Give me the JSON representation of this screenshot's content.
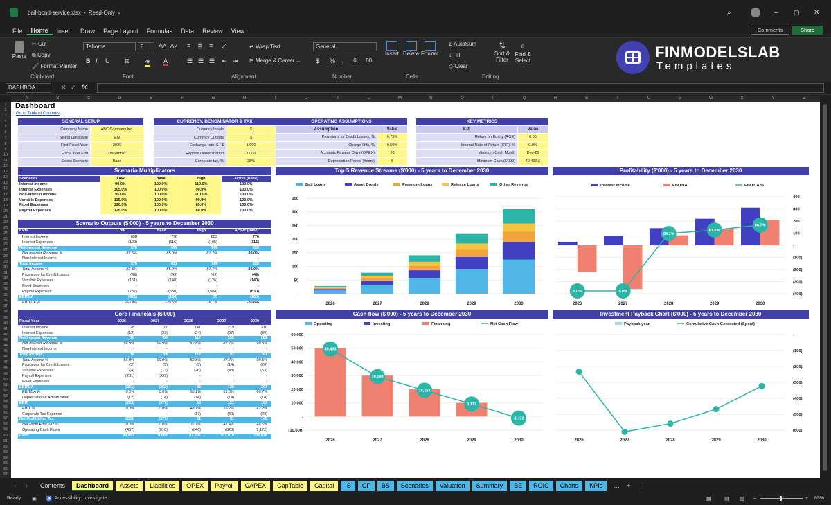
{
  "window": {
    "file": "bail-bond-service.xlsx",
    "mode": "Read-Only"
  },
  "menu": [
    "File",
    "Home",
    "Insert",
    "Draw",
    "Page Layout",
    "Formulas",
    "Data",
    "Review",
    "View"
  ],
  "buttons": {
    "comments": "Comments",
    "share": "Share"
  },
  "ribbon": {
    "paste": "Paste",
    "cut": "Cut",
    "copy": "Copy",
    "format_painter": "Format Painter",
    "clipboard": "Clipboard",
    "font_name": "Tahoma",
    "font_size": "8",
    "font": "Font",
    "wrap": "Wrap Text",
    "merge": "Merge & Center",
    "alignment": "Alignment",
    "number_format": "General",
    "number": "Number",
    "insert": "Insert",
    "delete": "Delete",
    "format": "Format",
    "cells": "Cells",
    "autosum": "AutoSum",
    "fill": "Fill",
    "clear": "Clear",
    "sort": "Sort & Filter",
    "find": "Find & Select",
    "editing": "Editing"
  },
  "brand": {
    "name": "FINMODELSLAB",
    "sub": "Templates"
  },
  "namebox": "DASHBOA...",
  "columns": [
    "A",
    "B",
    "C",
    "D",
    "E",
    "F",
    "G",
    "H",
    "I",
    "J",
    "K",
    "L",
    "M",
    "N",
    "O",
    "P",
    "Q",
    "R",
    "S",
    "T",
    "U",
    "V",
    "W",
    "X",
    "Y",
    "Z"
  ],
  "dash": {
    "title": "Dashboard",
    "link": "Go to Table of Contents"
  },
  "general": {
    "title": "GENERAL SETUP",
    "rows": [
      [
        "Company Name",
        "ABC Company Inc."
      ],
      [
        "Select Language",
        "EN"
      ],
      [
        "First Fiscal Year",
        "2026"
      ],
      [
        "Fiscal Year End",
        "December"
      ],
      [
        "Select Scenario",
        "Base"
      ]
    ]
  },
  "currency": {
    "title": "CURRENCY, DENOMINATOR & TAX",
    "rows": [
      [
        "Currency Inputs",
        "$"
      ],
      [
        "Currency Outputs",
        "$"
      ],
      [
        "Exchange rate, $ / $",
        "1.000"
      ],
      [
        "Reports Denomination",
        "1,000"
      ],
      [
        "Corporate tax, %",
        "25%"
      ]
    ]
  },
  "opassump": {
    "title": "OPERATING ASSUMPTIONS",
    "h1": "Assumption",
    "h2": "Value",
    "rows": [
      [
        "Provisions for Credit Losses, %",
        "0.75%"
      ],
      [
        "Charge-Offs, %",
        "0.50%"
      ],
      [
        "Accounts Payable Days (OPEX)",
        "20"
      ],
      [
        "Depreciation Period (Years)",
        "5"
      ]
    ]
  },
  "keym": {
    "title": "KEY METRICS",
    "h1": "KPI",
    "h2": "Value",
    "rows": [
      [
        "Return on Equity (ROE)",
        "0.00"
      ],
      [
        "Internal Rate of Return (IRR), %",
        "0.0%"
      ],
      [
        "Minimum Cash Month",
        "Dec-26"
      ],
      [
        "Minimum Cash ($'000)",
        "49,492.6"
      ]
    ]
  },
  "scen_mult": {
    "title": "Scenario Multiplicators",
    "head": [
      "Scenarios",
      "Low",
      "Base",
      "High",
      "Active (Base)"
    ],
    "rows": [
      [
        "Interest Income",
        "90.0%",
        "100.0%",
        "110.0%",
        "100.0%"
      ],
      [
        "Interest Expenses",
        "105.0%",
        "100.0%",
        "90.0%",
        "100.0%"
      ],
      [
        "Non-Interest Income",
        "95.0%",
        "100.0%",
        "110.0%",
        "100.0%"
      ],
      [
        "Variable Expenses",
        "115.0%",
        "100.0%",
        "90.0%",
        "100.0%"
      ],
      [
        "Fixed Expenses",
        "120.0%",
        "100.0%",
        "85.0%",
        "100.0%"
      ],
      [
        "Payroll Expenses",
        "125.0%",
        "100.0%",
        "80.0%",
        "100.0%"
      ]
    ]
  },
  "scen_out": {
    "title": "Scenario Outputs ($'000) - 5 years to December 2030",
    "head": [
      "KPIs",
      "Low",
      "Base",
      "High",
      "Active (Base)"
    ],
    "rows": [
      [
        "Interest Income",
        "698",
        "776",
        "853",
        "776",
        ""
      ],
      [
        "Interest Expenses",
        "(122)",
        "(116)",
        "(105)",
        "(116)",
        ""
      ],
      [
        "Net Interest Revenue",
        "576",
        "659",
        "749",
        "659",
        "c"
      ],
      [
        "Net Interest Revenue %",
        "82.5%",
        "85.0%",
        "87.7%",
        "85.0%",
        "i"
      ],
      [
        "Non-Interest Income",
        "-",
        "-",
        "-",
        "-",
        ""
      ],
      [
        "Total Income",
        "576",
        "659",
        "749",
        "659",
        "c"
      ],
      [
        "Total Income %",
        "82.5%",
        "85.0%",
        "87.7%",
        "85.0%",
        "i"
      ],
      [
        "Provisions for Credit Losses",
        "(49)",
        "(49)",
        "(49)",
        "(49)",
        ""
      ],
      [
        "Variable Expenses",
        "(161)",
        "(140)",
        "(126)",
        "(140)",
        ""
      ],
      [
        "Fixed Expenses",
        "-",
        "-",
        "-",
        "-",
        ""
      ],
      [
        "Payroll Expenses",
        "(787)",
        "(630)",
        "(504)",
        "(630)",
        ""
      ],
      [
        "EBITDA",
        "(421)",
        "(160)",
        "70",
        "(160)",
        "c"
      ],
      [
        "EBITDA %",
        "-60.4%",
        "-20.6%",
        "8.1%",
        "-20.6%",
        "i"
      ]
    ]
  },
  "core": {
    "title": "Core Financials ($'000)",
    "head": [
      "Fiscal Year",
      "2026",
      "2027",
      "2028",
      "2029",
      "2030"
    ],
    "rows": [
      [
        "Interest Income",
        "28",
        "77",
        "141",
        "219",
        "310",
        ""
      ],
      [
        "Interest Expenses",
        "(12)",
        "(23)",
        "(24)",
        "(27)",
        "(30)",
        ""
      ],
      [
        "Net Interest Revenue",
        "16",
        "54",
        "117",
        "192",
        "281",
        "c"
      ],
      [
        "Net Interest Revenue %",
        "56.8%",
        "69.9%",
        "82.8%",
        "87.7%",
        "90.5%",
        "i"
      ],
      [
        "Non-Interest Income",
        "-",
        "-",
        "-",
        "-",
        "-",
        ""
      ],
      [
        "Total Income",
        "16",
        "54",
        "117",
        "192",
        "281",
        "c"
      ],
      [
        "Total Income %",
        "56.8%",
        "69.9%",
        "82.8%",
        "87.7%",
        "90.5%",
        "i"
      ],
      [
        "Provisions for Credit Losses",
        "(2)",
        "(5)",
        "(9)",
        "(14)",
        "(20)",
        ""
      ],
      [
        "Variable Expenses",
        "(4)",
        "(13)",
        "(26)",
        "(43)",
        "(53)",
        ""
      ],
      [
        "Payroll Expenses",
        "(231)",
        "(399)",
        "-",
        "-",
        "-",
        ""
      ],
      [
        "Fixed Expenses",
        "-",
        "-",
        "-",
        "-",
        "-",
        ""
      ],
      [
        "EBITDA",
        "(221)",
        "(362)",
        "82",
        "135",
        "207",
        "c"
      ],
      [
        "EBITDA %",
        "0.0%",
        "0.0%",
        "58.1%",
        "61.6%",
        "66.7%",
        "i"
      ],
      [
        "Depreciation & Amortization",
        "(12)",
        "(14)",
        "(14)",
        "(14)",
        "(14)",
        ""
      ],
      [
        "EBIT",
        "(233)",
        "(377)",
        "68",
        "121",
        "193",
        "c"
      ],
      [
        "EBIT %",
        "0.0%",
        "0.0%",
        "48.1%",
        "55.2%",
        "62.2%",
        "i"
      ],
      [
        "Corporate Tax Expense",
        "-",
        "-",
        "(17)",
        "(30)",
        "(48)",
        ""
      ],
      [
        "Net Profit After Tax",
        "(233)",
        "(377)",
        "51",
        "91",
        "145",
        "c"
      ],
      [
        "Net Profit After Tax %",
        "0.0%",
        "0.0%",
        "36.1%",
        "41.4%",
        "46.6%",
        "i"
      ],
      [
        "Operating Cash Flows",
        "(437)",
        "(810)",
        "(846)",
        "(828)",
        "(1,172)",
        ""
      ],
      [
        "Cash",
        "49,493",
        "78,683",
        "97,837",
        "107,010",
        "105,838",
        "c"
      ]
    ]
  },
  "charts": {
    "rev": {
      "title": "Top 5 Revenue Streams ($'000) - 5 years to December 2030",
      "legend": [
        "Bail Loans",
        "Asset Bonds",
        "Premium Loans",
        "Release Loans",
        "Other Revenue"
      ],
      "colors": [
        "#4fb6e6",
        "#4040c0",
        "#f2a33a",
        "#f5c542",
        "#2bb5a8"
      ],
      "x": [
        "2026",
        "2027",
        "2028",
        "2029",
        "2030"
      ],
      "stacks": [
        [
          12,
          5,
          4,
          3,
          4
        ],
        [
          32,
          16,
          10,
          8,
          11
        ],
        [
          58,
          28,
          17,
          14,
          24
        ],
        [
          90,
          45,
          27,
          22,
          35
        ],
        [
          125,
          64,
          38,
          30,
          53
        ]
      ],
      "yticks": [
        "350",
        "300",
        "250",
        "200",
        "150",
        "100",
        "50",
        "-"
      ]
    },
    "prof": {
      "title": "Profitability ($'000) - 5 years to December 2030",
      "legend": [
        "Interest Income",
        "EBITDA",
        "EBITDA %"
      ],
      "x": [
        "2026",
        "2027",
        "2028",
        "2029",
        "2030"
      ],
      "income": [
        28,
        77,
        141,
        219,
        310
      ],
      "ebitda": [
        -221,
        -362,
        82,
        135,
        207
      ],
      "pct": [
        "0.0%",
        "0.0%",
        "58.1%",
        "61.6%",
        "66.7%"
      ],
      "pctv": [
        0,
        0,
        58.1,
        61.6,
        66.7
      ],
      "yticks": [
        "400",
        "300",
        "200",
        "100",
        "-",
        "(100)",
        "(200)",
        "(300)",
        "(400)"
      ]
    },
    "cash": {
      "title": "Cash flow ($'000) - 5 years to December 2030",
      "legend": [
        "Operating",
        "Investing",
        "Financing",
        "Net Cash Flow"
      ],
      "x": [
        "2026",
        "2027",
        "2028",
        "2029",
        "2030"
      ],
      "fin": [
        50000,
        30000,
        20000,
        10000,
        0
      ],
      "net": [
        49493,
        29190,
        19154,
        9172,
        -1172
      ],
      "labels": [
        "49,493",
        "29,190",
        "19,154",
        "9,172",
        "-1,172"
      ],
      "yticks": [
        "60,000",
        "50,000",
        "40,000",
        "30,000",
        "20,000",
        "10,000",
        "-",
        "(10,000)"
      ]
    },
    "payback": {
      "title": "Investment Payback Chart ($'000) - 5 years to December 2030",
      "legend": [
        "Payback year",
        "Cumulative Cash Generated (Spent)"
      ],
      "x": [
        "2026",
        "2027",
        "2028",
        "2029",
        "2030"
      ],
      "cum": [
        -233,
        -610,
        -559,
        -468,
        -323
      ],
      "yticks": [
        "-",
        "(100)",
        "(200)",
        "(300)",
        "(400)",
        "(500)",
        "(600)"
      ]
    }
  },
  "sheets": [
    "Contents",
    "Dashboard",
    "Assets",
    "Liabilities",
    "OPEX",
    "Payroll",
    "CAPEX",
    "CapTable",
    "Capital",
    "IS",
    "CF",
    "BS",
    "Scenarios",
    "Valuation",
    "Summary",
    "BE",
    "ROIC",
    "Charts",
    "KPIs"
  ],
  "status": {
    "ready": "Ready",
    "access": "Accessibility: Investigate",
    "zoom": "89%"
  }
}
